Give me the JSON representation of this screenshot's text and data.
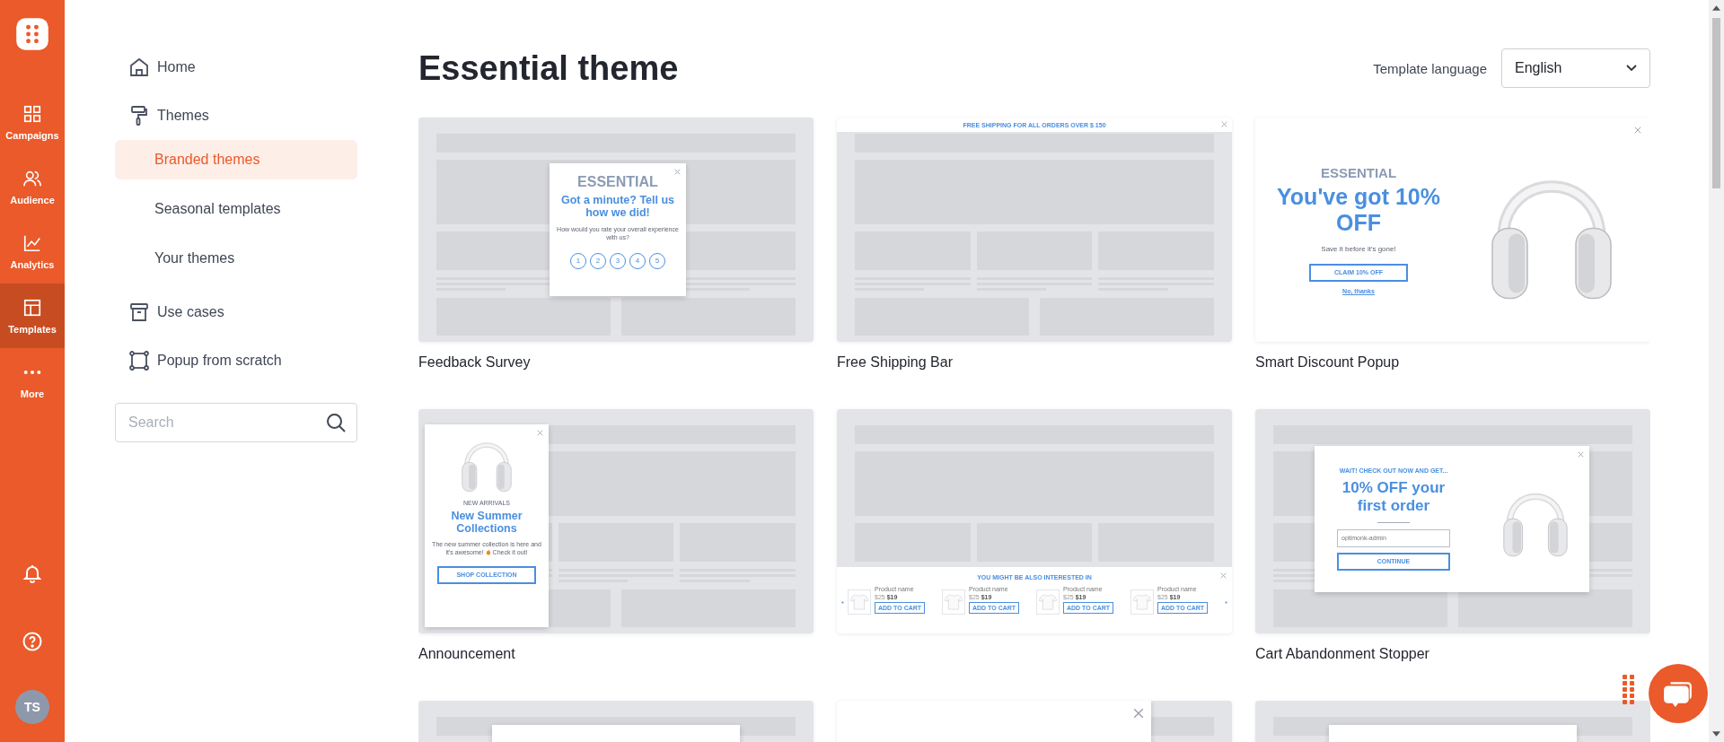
{
  "rail": {
    "items": [
      {
        "kind": "grid",
        "label": "Campaigns",
        "selected": false
      },
      {
        "kind": "people",
        "label": "Audience",
        "selected": false
      },
      {
        "kind": "chart",
        "label": "Analytics",
        "selected": false
      },
      {
        "kind": "layout",
        "label": "Templates",
        "selected": true
      },
      {
        "kind": "dots",
        "label": "More",
        "selected": false
      }
    ],
    "avatar": "TS"
  },
  "nav": {
    "items": [
      {
        "kind": "home",
        "label": "Home",
        "selected": false
      },
      {
        "kind": "roller",
        "label": "Themes",
        "selected": false,
        "expanded": true,
        "children": [
          {
            "label": "Branded themes",
            "selected": true
          },
          {
            "label": "Seasonal templates",
            "selected": false
          },
          {
            "label": "Your themes",
            "selected": false
          }
        ]
      },
      {
        "kind": "box",
        "label": "Use cases",
        "selected": false
      },
      {
        "kind": "frame",
        "label": "Popup from scratch",
        "selected": false
      }
    ],
    "search": {
      "placeholder": "Search"
    }
  },
  "page": {
    "title": "Essential theme",
    "language_label": "Template language",
    "language": "English"
  },
  "templates": [
    {
      "kind": "survey",
      "label": "Feedback Survey",
      "brand": "ESSENTIAL",
      "headline": "Got a minute? Tell us how we did!",
      "body": "How would you rate your overall experience with us?",
      "ratings": [
        "1",
        "2",
        "3",
        "4",
        "5"
      ]
    },
    {
      "kind": "bar",
      "label": "Free Shipping Bar",
      "bar_text": "FREE SHIPPING FOR ALL ORDERS OVER $ 150"
    },
    {
      "kind": "discount",
      "label": "Smart Discount Popup",
      "brand": "ESSENTIAL",
      "headline": "You've got 10% OFF",
      "body": "Save it before it's gone!",
      "button": "CLAIM 10% OFF",
      "link": "No, thanks"
    },
    {
      "kind": "announcement",
      "label": "Announcement",
      "eyebrow": "NEW ARRIVALS",
      "headline": "New Summer Collections",
      "body_before": "The new summer collection is here and it's awesome!",
      "body_after": "Check it out!",
      "button": "SHOP COLLECTION"
    },
    {
      "kind": "recommendation",
      "title": "YOU MIGHT BE ALSO INTERESTED IN",
      "products": [
        {
          "name": "Product name",
          "old_price": "$25",
          "price": "$19",
          "button": "ADD TO CART"
        },
        {
          "name": "Product name",
          "old_price": "$25",
          "price": "$19",
          "button": "ADD TO CART"
        },
        {
          "name": "Product name",
          "old_price": "$25",
          "price": "$19",
          "button": "ADD TO CART"
        },
        {
          "name": "Product name",
          "old_price": "$25",
          "price": "$19",
          "button": "ADD TO CART"
        }
      ]
    },
    {
      "kind": "cart",
      "label": "Cart Abandonment Stopper",
      "eyebrow": "WAIT! CHECK OUT NOW AND GET...",
      "headline": "10% OFF your first order",
      "input": "optimonk-admin",
      "button": "CONTINUE"
    },
    {
      "kind": "overlay"
    },
    {
      "kind": "wheel"
    },
    {
      "kind": "overlay"
    }
  ]
}
